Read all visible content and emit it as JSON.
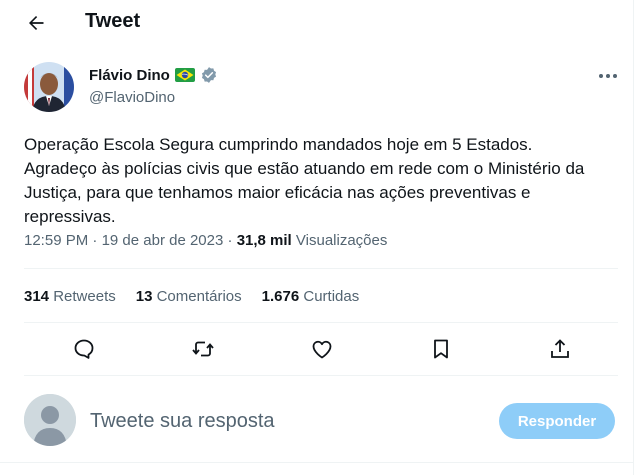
{
  "header": {
    "title": "Tweet",
    "back_icon": "arrow-left-icon"
  },
  "tweet": {
    "author_name": "Flávio Dino",
    "flag_icon": "brazil-flag-icon",
    "verified_icon": "verified-badge-icon",
    "handle": "@FlavioDino",
    "more_icon": "more-horizontal-icon",
    "text": "Operação Escola Segura cumprindo mandados hoje em 5 Estados.\nAgradeço às polícias civis que estão atuando em rede com o Ministério da Justiça, para que tenhamos maior eficácia nas ações preventivas e repressivas.",
    "time": "12:59 PM",
    "date": "19 de abr de 2023",
    "separator": "·",
    "views_count": "31,8 mil",
    "views_label": "Visualizações"
  },
  "stats": [
    {
      "count": "314",
      "label": "Retweets"
    },
    {
      "count": "13",
      "label": "Comentários"
    },
    {
      "count": "1.676",
      "label": "Curtidas"
    }
  ],
  "actions": [
    "reply-icon",
    "retweet-icon",
    "like-icon",
    "bookmark-icon",
    "share-icon"
  ],
  "reply": {
    "placeholder": "Tweete sua resposta",
    "button_label": "Responder"
  },
  "colors": {
    "text": "#0f1419",
    "secondary": "#536471",
    "accent_disabled": "#8ecdf8",
    "divider": "#eff3f4",
    "verified": "#829aab"
  }
}
